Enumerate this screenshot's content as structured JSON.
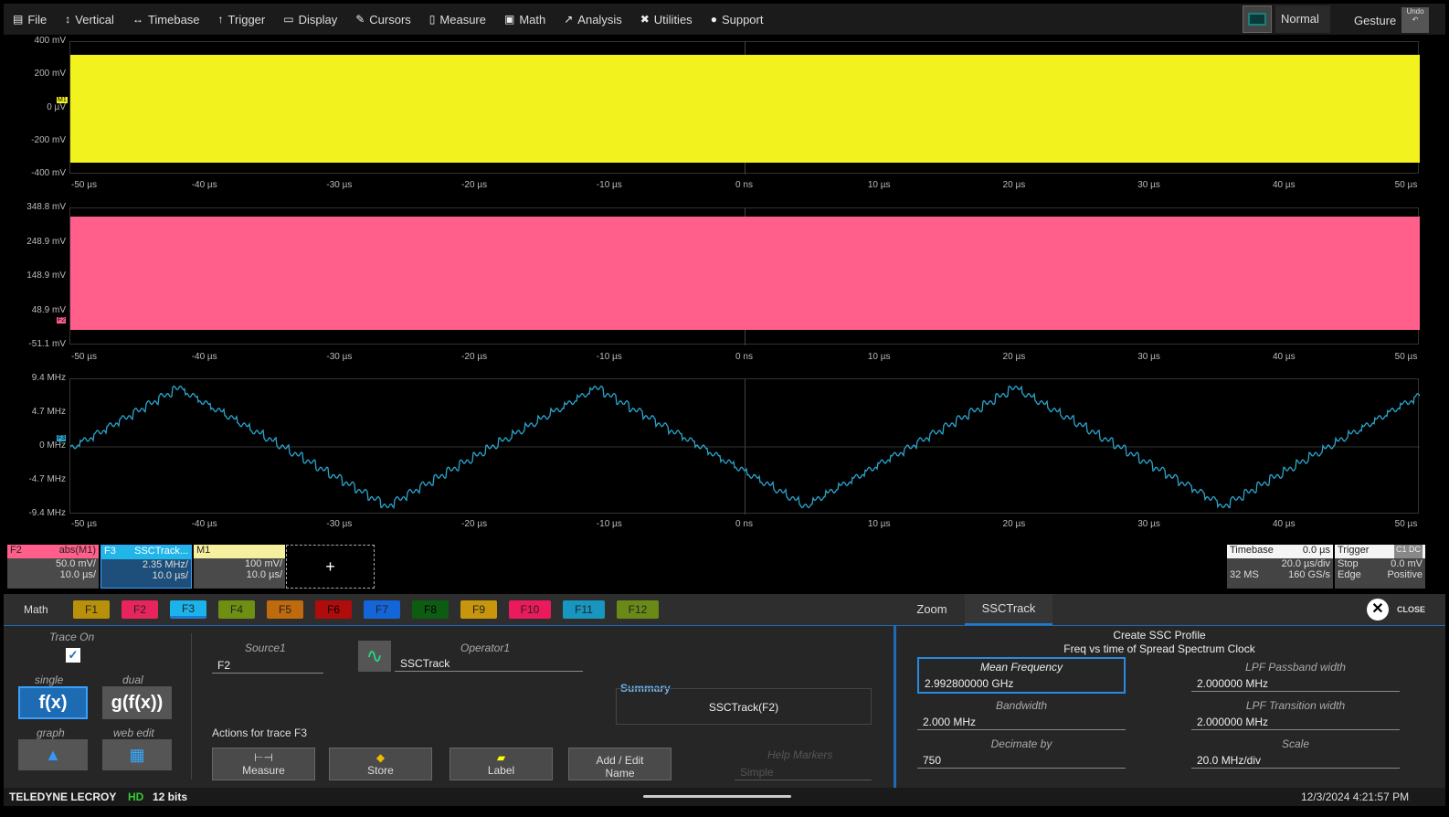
{
  "menu": [
    {
      "icon": "file-icon",
      "label": "File"
    },
    {
      "icon": "vertical-icon",
      "label": "Vertical"
    },
    {
      "icon": "timebase-icon",
      "label": "Timebase"
    },
    {
      "icon": "trigger-icon",
      "label": "Trigger"
    },
    {
      "icon": "display-icon",
      "label": "Display"
    },
    {
      "icon": "cursors-icon",
      "label": "Cursors"
    },
    {
      "icon": "measure-icon",
      "label": "Measure"
    },
    {
      "icon": "math-icon",
      "label": "Math"
    },
    {
      "icon": "analysis-icon",
      "label": "Analysis"
    },
    {
      "icon": "utilities-icon",
      "label": "Utilities"
    },
    {
      "icon": "support-icon",
      "label": "Support"
    }
  ],
  "topright": {
    "mode": "Normal",
    "gesture": "Gesture",
    "undo": "Undo"
  },
  "grids": [
    {
      "trace": "M1",
      "color": "#f2f21e",
      "ylabels": [
        "400 mV",
        "200 mV",
        "0 µV",
        "-200 mV",
        "-400 mV"
      ],
      "marker": "M1"
    },
    {
      "trace": "F2",
      "color": "#ff5f8a",
      "ylabels": [
        "348.8 mV",
        "248.9 mV",
        "148.9 mV",
        "48.9 mV",
        "-51.1 mV"
      ],
      "marker": "F2"
    },
    {
      "trace": "F3",
      "color": "#2aa6cf",
      "ylabels": [
        "9.4 MHz",
        "4.7 MHz",
        "0 MHz",
        "-4.7 MHz",
        "-9.4 MHz"
      ],
      "marker": "F3"
    }
  ],
  "xlabels": [
    "-50 µs",
    "-40 µs",
    "-30 µs",
    "-20 µs",
    "-10 µs",
    "0 ns",
    "10 µs",
    "20 µs",
    "30 µs",
    "40 µs",
    "50 µs"
  ],
  "descriptors": [
    {
      "name": "F2",
      "func": "abs(M1)",
      "v": "50.0 mV/",
      "h": "10.0 µs/",
      "color": "#ff5f8a"
    },
    {
      "name": "F3",
      "func": "SSCTrack...",
      "v": "2.35 MHz/",
      "h": "10.0 µs/",
      "color": "#21b5e8"
    },
    {
      "name": "M1",
      "func": "",
      "v": "100 mV/",
      "h": "10.0 µs/",
      "color": "#f5f0a0"
    }
  ],
  "add_trace": "+",
  "timebase": {
    "title": "Timebase",
    "delay": "0.0 µs",
    "div": "20.0 µs/div",
    "samples": "32 MS",
    "rate": "160 GS/s"
  },
  "trigger": {
    "title": "Trigger",
    "src": "C1 DC",
    "state": "Stop",
    "level": "0.0 mV",
    "type": "Edge",
    "slope": "Positive"
  },
  "math_label": "Math",
  "ftabs": [
    {
      "l": "F1",
      "c": "#b8900a"
    },
    {
      "l": "F2",
      "c": "#e8245c"
    },
    {
      "l": "F3",
      "c": "#1ab4ea"
    },
    {
      "l": "F4",
      "c": "#6f8f12"
    },
    {
      "l": "F5",
      "c": "#c06a0e"
    },
    {
      "l": "F6",
      "c": "#b00c0c"
    },
    {
      "l": "F7",
      "c": "#1466d8"
    },
    {
      "l": "F8",
      "c": "#0c5c12"
    },
    {
      "l": "F9",
      "c": "#c8960c"
    },
    {
      "l": "F10",
      "c": "#ea1a5c"
    },
    {
      "l": "F11",
      "c": "#1796c0"
    },
    {
      "l": "F12",
      "c": "#6a8a18"
    }
  ],
  "righttabs": [
    "Zoom",
    "SSCTrack"
  ],
  "close": "CLOSE",
  "panel": {
    "trace_on": "Trace On",
    "trace_on_checked": true,
    "single": "single",
    "dual": "dual",
    "fx": "f(x)",
    "gfx": "g(f(x))",
    "graph": "graph",
    "webedit": "web edit",
    "source_label": "Source1",
    "source": "F2",
    "operator_label": "Operator1",
    "operator": "SSCTrack",
    "summary_label": "Summary",
    "summary": "SSCTrack(F2)",
    "actions": "Actions for trace F3",
    "buttons": [
      "Measure",
      "Store",
      "Label",
      "Add / Edit Name"
    ],
    "help_markers": "Help Markers",
    "help_value": "Simple"
  },
  "ssc": {
    "title": "Create SSC Profile",
    "subtitle": "Freq vs time of Spread Spectrum Clock",
    "fields": [
      {
        "label": "Mean Frequency",
        "value": "2.992800000 GHz"
      },
      {
        "label": "LPF Passband width",
        "value": "2.000000 MHz"
      },
      {
        "label": "Bandwidth",
        "value": "2.000 MHz"
      },
      {
        "label": "LPF Transition width",
        "value": "2.000000 MHz"
      },
      {
        "label": "Decimate by",
        "value": "750"
      },
      {
        "label": "Scale",
        "value": "20.0 MHz/div"
      }
    ]
  },
  "status": {
    "brand": "TELEDYNE LECROY",
    "hd": "HD",
    "bits": "12 bits",
    "datetime": "12/3/2024 4:21:57 PM"
  }
}
